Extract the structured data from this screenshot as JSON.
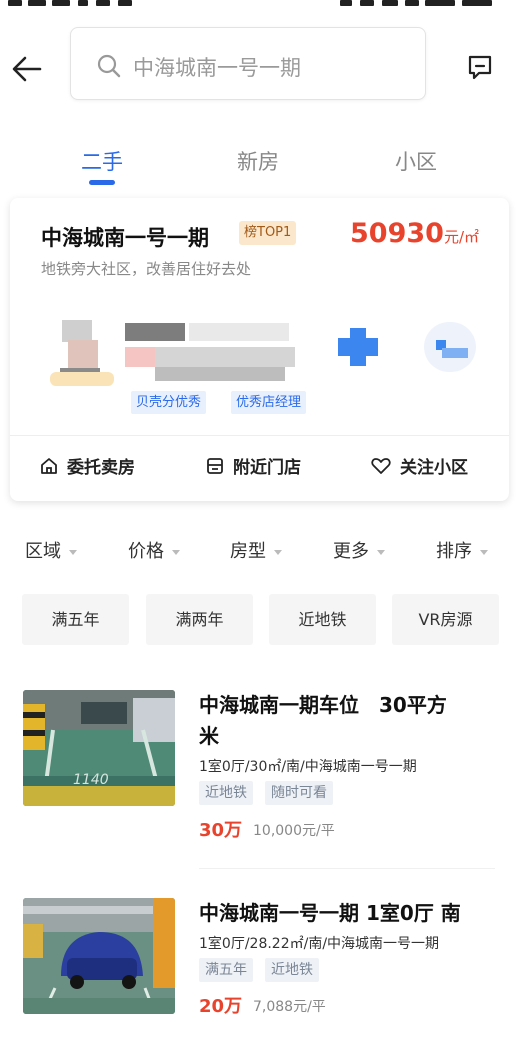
{
  "search": {
    "placeholder": "中海城南一号一期"
  },
  "tabs": [
    {
      "label": "二手",
      "active": true
    },
    {
      "label": "新房",
      "active": false
    },
    {
      "label": "小区",
      "active": false
    }
  ],
  "community": {
    "name": "中海城南一号一期",
    "badge": "榜TOP1",
    "price": "50930",
    "price_unit": "元/㎡",
    "subtitle": "地铁旁大社区，改善居住好去处",
    "agent_tags": [
      "贝壳分优秀",
      "优秀店经理"
    ],
    "actions": [
      {
        "label": "委托卖房",
        "icon": "home-icon"
      },
      {
        "label": "附近门店",
        "icon": "store-icon"
      },
      {
        "label": "关注小区",
        "icon": "heart-icon"
      }
    ]
  },
  "filters": [
    "区域",
    "价格",
    "房型",
    "更多",
    "排序"
  ],
  "chips": [
    "满五年",
    "满两年",
    "近地铁",
    "VR房源"
  ],
  "listings": [
    {
      "title_line1": "中海城南一期车位　30平方",
      "title_line2": "米",
      "meta": "1室0厅/30㎡/南/中海城南一号一期",
      "tags": [
        "近地铁",
        "随时可看"
      ],
      "price": "30万",
      "unit_price": "10,000元/平",
      "thumb_text": "1140"
    },
    {
      "title_line1": "中海城南一号一期 1室0厅 南",
      "meta": "1室0厅/28.22㎡/南/中海城南一号一期",
      "tags": [
        "满五年",
        "近地铁"
      ],
      "price": "20万",
      "unit_price": "7,088元/平"
    }
  ],
  "colors": {
    "accent": "#2a6ae9",
    "price": "#e8442d"
  }
}
